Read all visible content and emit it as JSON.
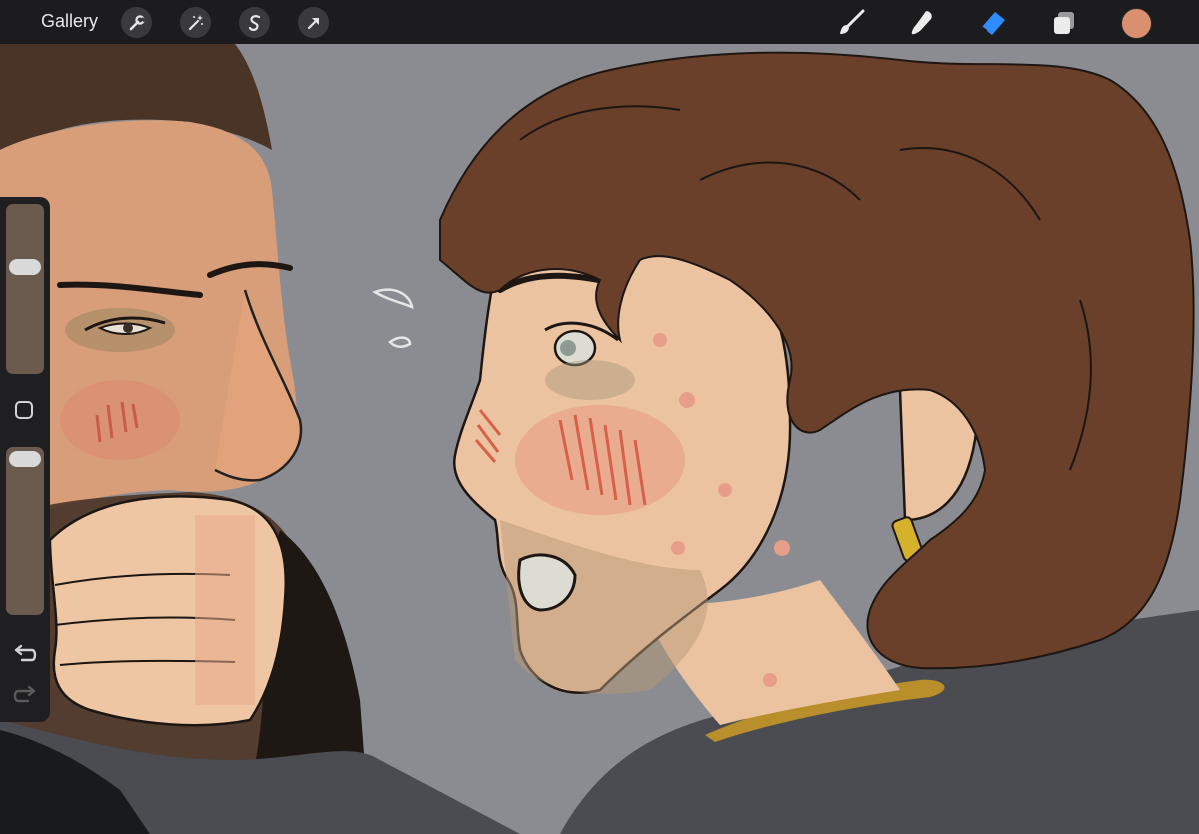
{
  "toolbar": {
    "gallery_label": "Gallery",
    "left_tools": [
      "wrench-icon",
      "magic-wand-icon",
      "selection-s-icon",
      "transform-arrow-icon"
    ],
    "right_tools": [
      "brush-icon",
      "smudge-icon",
      "eraser-icon",
      "layers-icon"
    ],
    "active_tool": "eraser-icon",
    "accent_color": "#2f8cff",
    "current_color": "#d9906f"
  },
  "sidebar": {
    "brush_size_level": 0.65,
    "opacity_level": 1.0,
    "controls": [
      "brush-size-slider",
      "modify-button",
      "opacity-slider",
      "undo-icon",
      "redo-icon"
    ]
  },
  "canvas": {
    "background_color": "#8b8c91",
    "artwork": "digital-painting"
  }
}
